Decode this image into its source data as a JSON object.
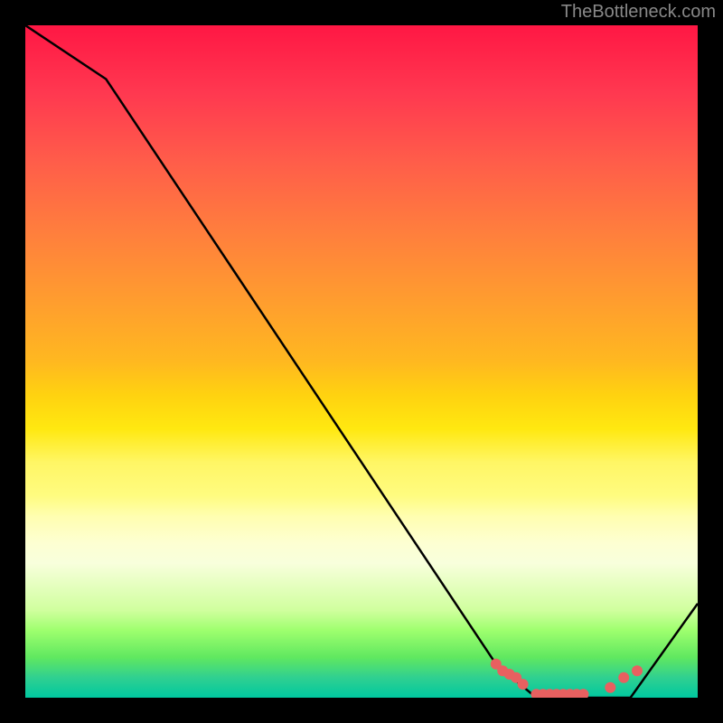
{
  "attribution": "TheBottleneck.com",
  "chart_data": {
    "type": "line",
    "title": "",
    "xlabel": "",
    "ylabel": "",
    "xlim": [
      0,
      100
    ],
    "ylim": [
      0,
      100
    ],
    "curve": {
      "x": [
        0,
        12,
        70,
        76,
        90,
        100
      ],
      "y": [
        100,
        92,
        5,
        0,
        0,
        14
      ]
    },
    "markers": {
      "x": [
        70,
        71,
        72,
        73,
        74,
        76,
        77,
        78,
        79,
        80,
        81,
        82,
        83,
        87,
        89,
        91
      ],
      "y": [
        5,
        4,
        3.5,
        3,
        2,
        0.5,
        0.5,
        0.5,
        0.5,
        0.5,
        0.5,
        0.5,
        0.5,
        1.5,
        3,
        4
      ]
    },
    "marker_color": "#e86060",
    "curve_color": "#000000"
  }
}
